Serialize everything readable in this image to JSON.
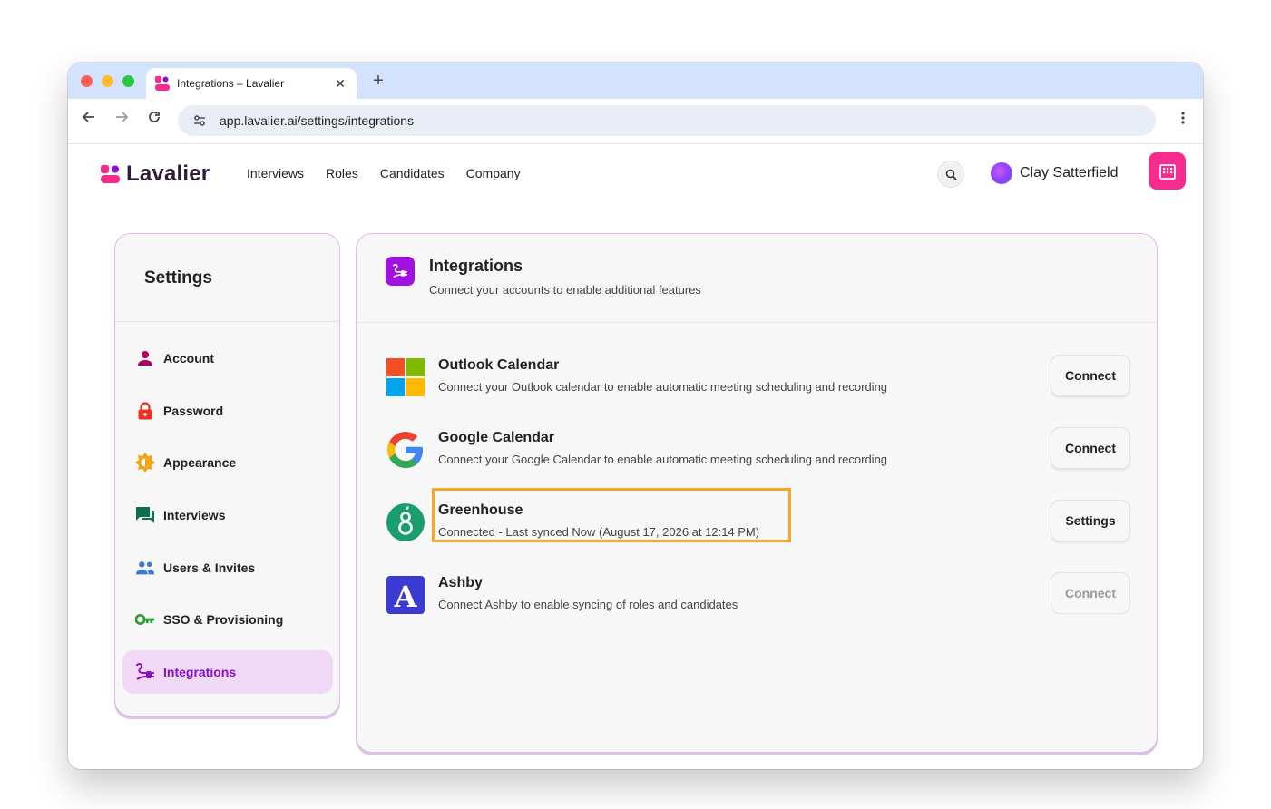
{
  "browser": {
    "tab_title": "Integrations – Lavalier",
    "url": "app.lavalier.ai/settings/integrations"
  },
  "app": {
    "logo_text": "Lavalier",
    "nav": [
      "Interviews",
      "Roles",
      "Candidates",
      "Company"
    ],
    "user_name": "Clay Satterfield",
    "colors": {
      "brand_pink": "#f72a8e",
      "accent_purple": "#a112e0",
      "highlight_orange": "#f5a623"
    }
  },
  "settings": {
    "title": "Settings",
    "items": [
      {
        "label": "Account",
        "icon": "person-icon"
      },
      {
        "label": "Password",
        "icon": "lock-icon"
      },
      {
        "label": "Appearance",
        "icon": "sun-icon"
      },
      {
        "label": "Interviews",
        "icon": "chat-icon"
      },
      {
        "label": "Users & Invites",
        "icon": "users-icon"
      },
      {
        "label": "SSO & Provisioning",
        "icon": "key-icon"
      },
      {
        "label": "Integrations",
        "icon": "plug-icon",
        "active": true
      }
    ]
  },
  "integrations": {
    "title": "Integrations",
    "subtitle": "Connect your accounts to enable additional features",
    "items": [
      {
        "name": "Outlook Calendar",
        "description": "Connect your Outlook calendar to enable automatic meeting scheduling and recording",
        "button": "Connect",
        "logo": "microsoft-logo-icon"
      },
      {
        "name": "Google Calendar",
        "description": "Connect your Google Calendar to enable automatic meeting scheduling and recording",
        "button": "Connect",
        "logo": "google-logo-icon"
      },
      {
        "name": "Greenhouse",
        "description": "Connected - Last synced Now (August 17, 2026 at 12:14 PM)",
        "button": "Settings",
        "logo": "greenhouse-logo-icon",
        "highlighted": true
      },
      {
        "name": "Ashby",
        "description": "Connect Ashby to enable syncing of roles and candidates",
        "button": "Connect",
        "logo": "ashby-logo-icon",
        "disabled": true
      }
    ]
  }
}
